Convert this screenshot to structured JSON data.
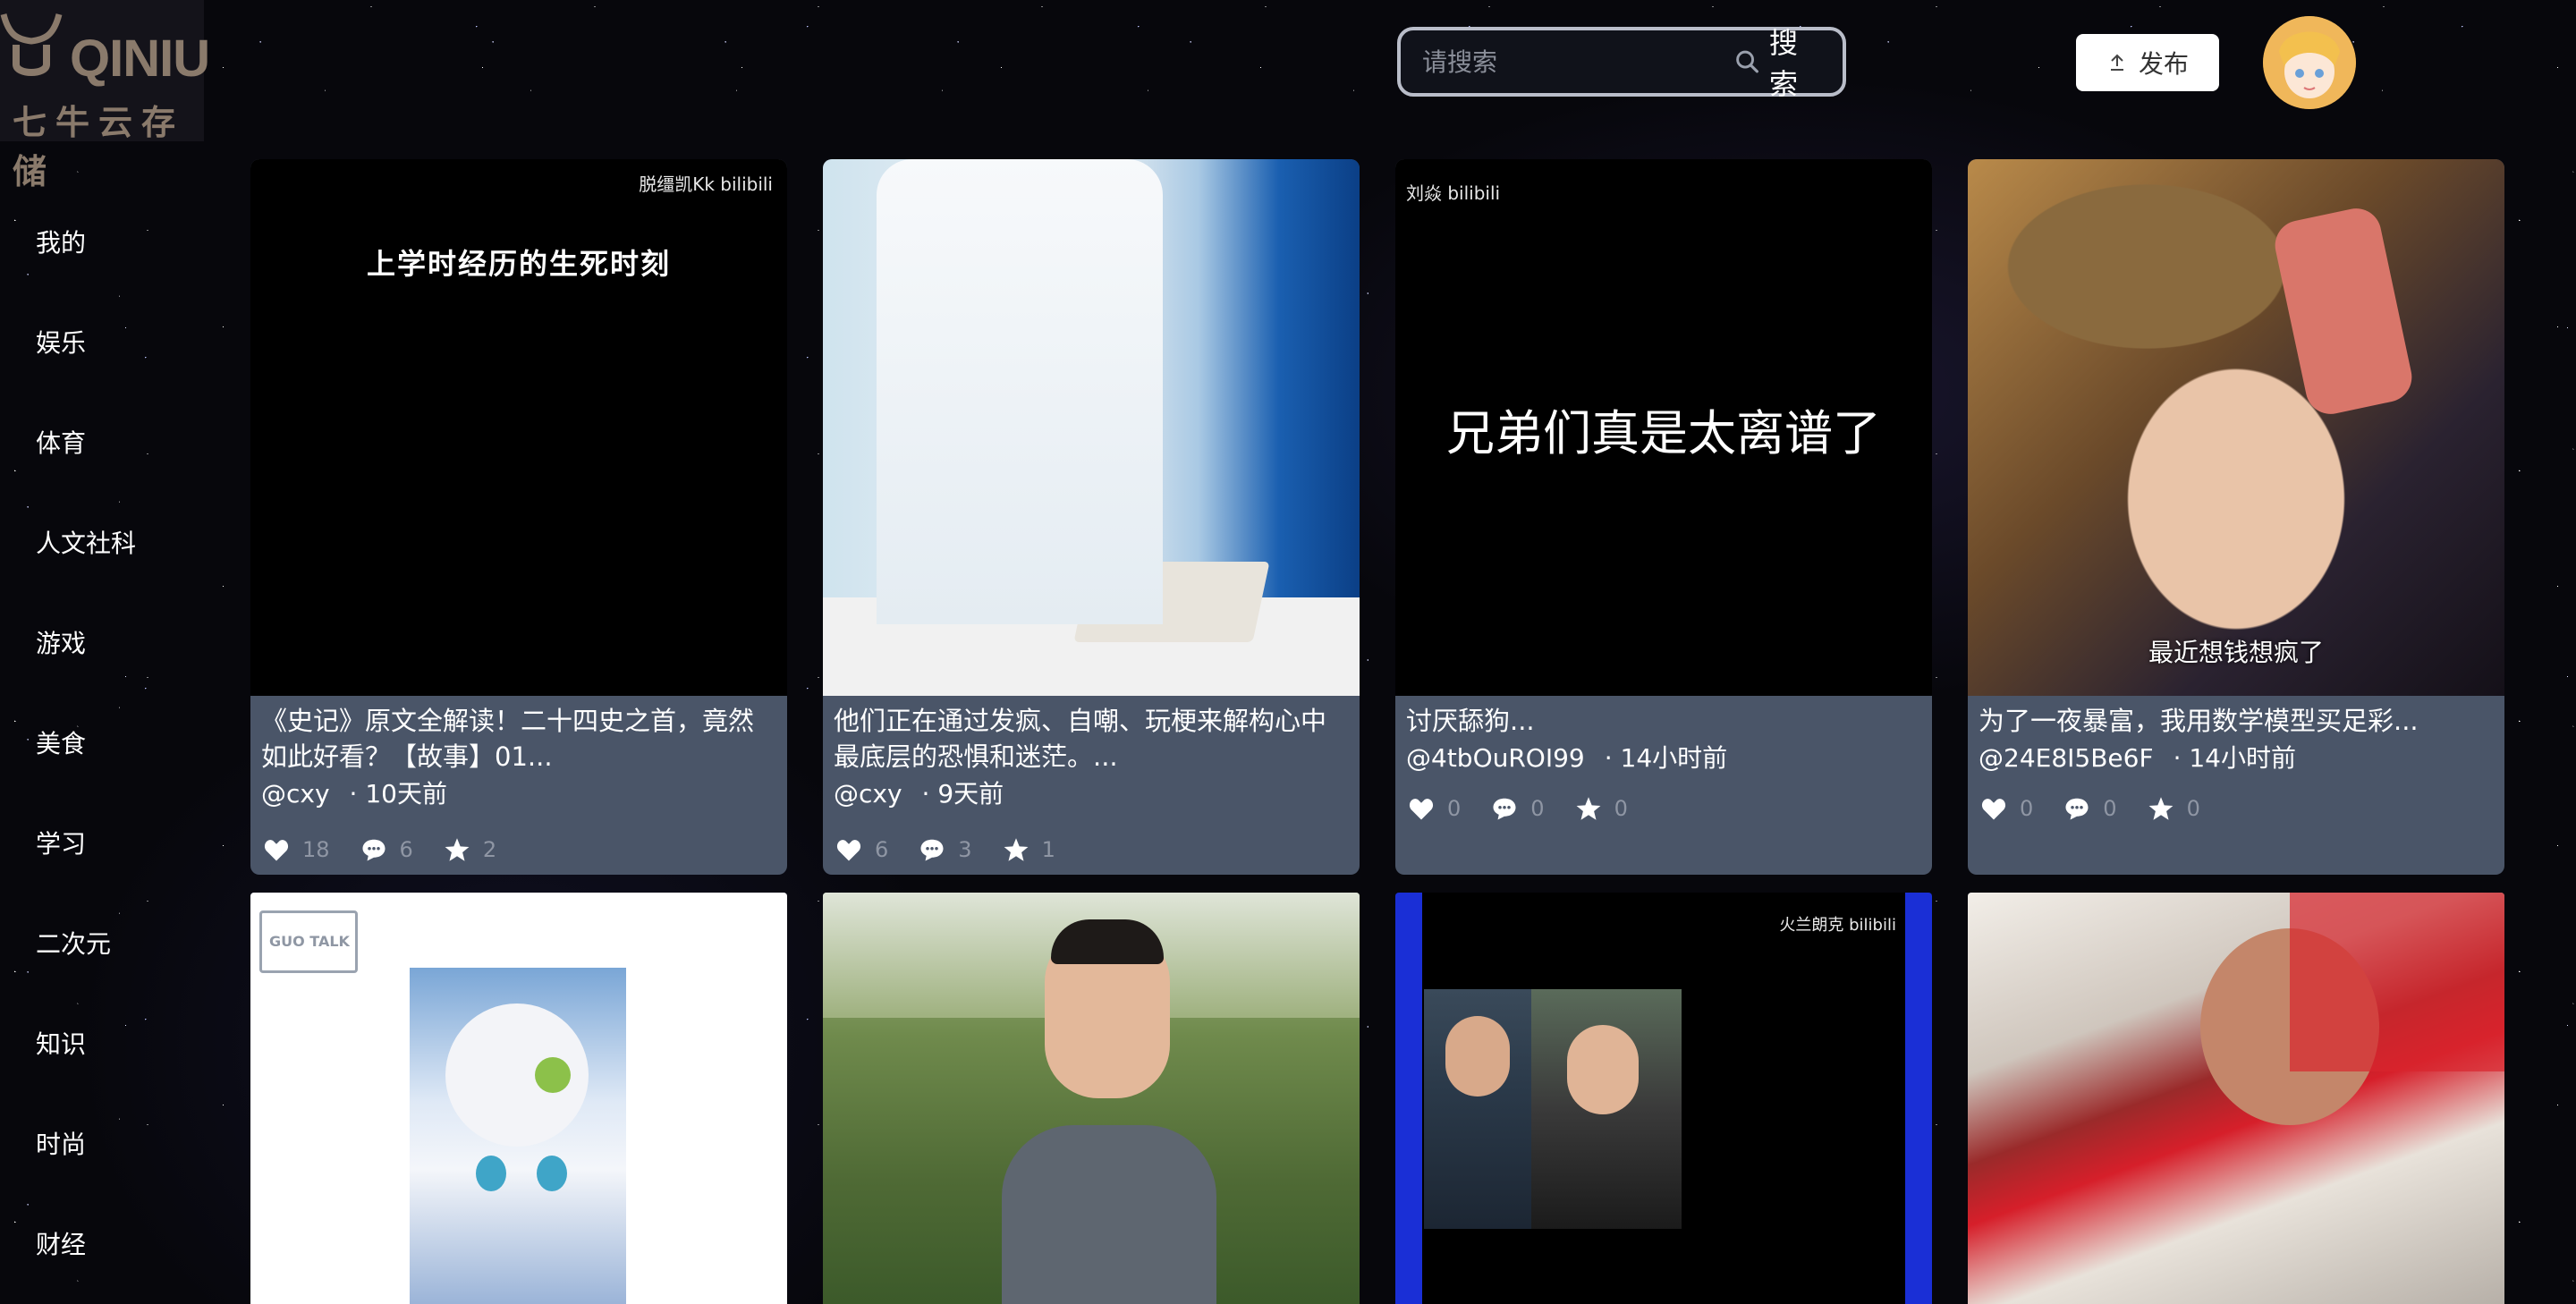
{
  "brand": {
    "logo_word": "QINIU",
    "logo_sub": "七牛云存储"
  },
  "sidebar": {
    "items": [
      {
        "label": "我的"
      },
      {
        "label": "娱乐"
      },
      {
        "label": "体育"
      },
      {
        "label": "人文社科"
      },
      {
        "label": "游戏"
      },
      {
        "label": "美食"
      },
      {
        "label": "学习"
      },
      {
        "label": "二次元"
      },
      {
        "label": "知识"
      },
      {
        "label": "时尚"
      },
      {
        "label": "财经"
      }
    ]
  },
  "search": {
    "placeholder": "请搜索",
    "button_label": "搜索",
    "icon": "search-icon"
  },
  "publish": {
    "label": "发布",
    "icon": "upload-icon"
  },
  "avatar": {
    "icon": "user-avatar"
  },
  "cards": [
    {
      "thumb_text": "上学时经历的生死时刻",
      "watermark": "脱缰凯Kk bilibili",
      "title": "《史记》原文全解读！二十四史之首，竟然如此好看？【故事】01...",
      "author": "@cxy",
      "time": "· 10天前",
      "likes": "18",
      "comments": "6",
      "favorites": "2"
    },
    {
      "thumb_text": "",
      "watermark": "",
      "title": "他们正在通过发疯、自嘲、玩梗来解构心中最底层的恐惧和迷茫。...",
      "author": "@cxy",
      "time": "· 9天前",
      "likes": "6",
      "comments": "3",
      "favorites": "1"
    },
    {
      "thumb_text": "兄弟们真是太离谱了",
      "watermark": "刘焱 bilibili",
      "title": "讨厌舔狗...",
      "author": "@4tbOuROI99",
      "time": "· 14小时前",
      "likes": "0",
      "comments": "0",
      "favorites": "0"
    },
    {
      "thumb_text": "最近想钱想疯了",
      "watermark": "",
      "title": "为了一夜暴富，我用数学模型买足彩...",
      "author": "@24E8I5Be6F",
      "time": "· 14小时前",
      "likes": "0",
      "comments": "0",
      "favorites": "0"
    },
    {
      "thumb_text": "",
      "watermark": "GUO TALK",
      "title": "",
      "author": "",
      "time": "",
      "likes": "",
      "comments": "",
      "favorites": ""
    },
    {
      "thumb_text": "",
      "watermark": "",
      "title": "",
      "author": "",
      "time": "",
      "likes": "",
      "comments": "",
      "favorites": ""
    },
    {
      "thumb_text": "",
      "watermark": "火兰朗克 bilibili",
      "title": "",
      "author": "",
      "time": "",
      "likes": "",
      "comments": "",
      "favorites": ""
    },
    {
      "thumb_text": "",
      "watermark": "",
      "title": "",
      "author": "",
      "time": "",
      "likes": "",
      "comments": "",
      "favorites": ""
    }
  ],
  "colors": {
    "background": "#07070c",
    "card_info": "#4a5568",
    "stat_text": "#8f96a4",
    "brand": "#8a7a6b"
  }
}
